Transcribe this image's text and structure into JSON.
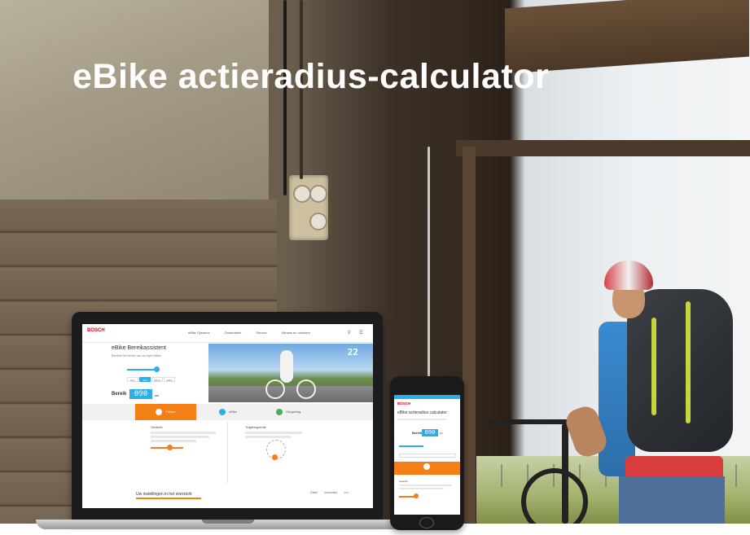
{
  "hero": {
    "title": "eBike actieradius-calculator"
  },
  "laptop_screen": {
    "brand": "BOSCH",
    "nav_items": [
      "eBike Systems",
      "Onderdelen",
      "Service",
      "Nieuws en verhalen"
    ],
    "page_title": "eBike Bereikassistent",
    "page_subtitle": "Bereken het bereik van uw eigen eBike",
    "mode_options": [
      "Eco",
      "Tour",
      "Sport",
      "Turbo"
    ],
    "active_mode_index": 1,
    "range_label": "Bereik",
    "range_value": "090",
    "range_unit": "km",
    "speed_display": "22",
    "tabs": [
      {
        "label": "Fietser"
      },
      {
        "label": "eBike"
      },
      {
        "label": "Omgeving"
      }
    ],
    "active_tab_index": 0,
    "section_left_title": "Gewicht",
    "section_right_title": "Trapfrequentie",
    "overview_title": "Uw instellingen in het overzicht",
    "overview_tabs": [
      "Delen",
      "Instructies",
      "Info"
    ]
  },
  "phone_screen": {
    "brand": "BOSCH",
    "page_title": "eBike actieradius calculator",
    "range_label": "Bereik",
    "range_value": "090",
    "range_unit": "km",
    "section_title": "Gewicht"
  },
  "colors": {
    "accent_blue": "#2caeea",
    "accent_orange": "#f57f17",
    "brand_red": "#e20015"
  }
}
